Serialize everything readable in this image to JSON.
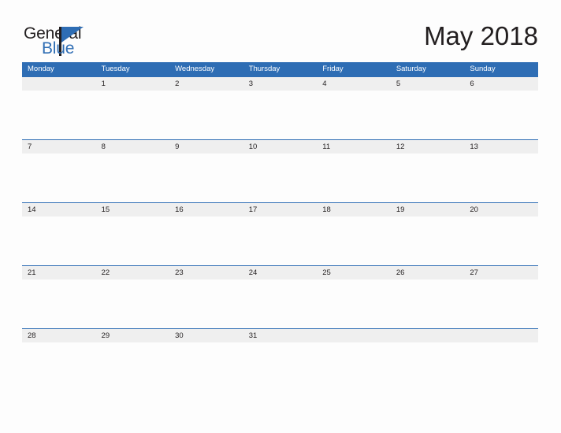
{
  "brand": {
    "name_part1": "General",
    "name_part2": "Blue",
    "accent_color": "#2e6db4",
    "text_color": "#231f20"
  },
  "header": {
    "title": "May 2018"
  },
  "calendar": {
    "month": "May",
    "year": "2018",
    "header_bg": "#2e6db4",
    "band_bg": "#efefef",
    "weekdays": [
      "Monday",
      "Tuesday",
      "Wednesday",
      "Thursday",
      "Friday",
      "Saturday",
      "Sunday"
    ],
    "weeks": [
      [
        "",
        "1",
        "2",
        "3",
        "4",
        "5",
        "6"
      ],
      [
        "7",
        "8",
        "9",
        "10",
        "11",
        "12",
        "13"
      ],
      [
        "14",
        "15",
        "16",
        "17",
        "18",
        "19",
        "20"
      ],
      [
        "21",
        "22",
        "23",
        "24",
        "25",
        "26",
        "27"
      ],
      [
        "28",
        "29",
        "30",
        "31",
        "",
        "",
        ""
      ]
    ]
  }
}
